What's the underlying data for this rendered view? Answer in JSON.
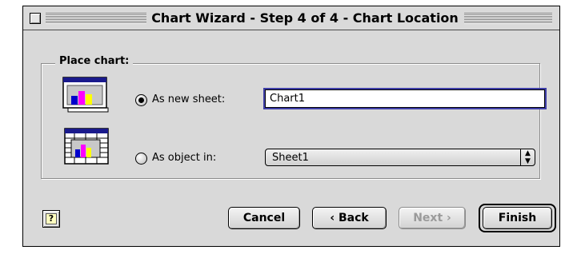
{
  "window": {
    "title": "Chart Wizard - Step 4 of 4 - Chart Location"
  },
  "place_chart": {
    "label": "Place chart:",
    "as_new_sheet": {
      "label": "As new sheet:",
      "selected": true,
      "value": "Chart1"
    },
    "as_object_in": {
      "label": "As object in:",
      "selected": false,
      "selected_option": "Sheet1"
    }
  },
  "buttons": {
    "help": "?",
    "cancel": "Cancel",
    "back": "‹ Back",
    "next": "Next ›",
    "finish": "Finish"
  },
  "colors": {
    "bar_blue": "#0000cc",
    "bar_magenta": "#ff00ff",
    "bar_yellow": "#ffff00",
    "focus_ring": "#3f3fa8"
  },
  "icons": {
    "new_sheet": "chart-sheet-icon",
    "embedded": "embedded-chart-icon",
    "help": "help-icon"
  }
}
